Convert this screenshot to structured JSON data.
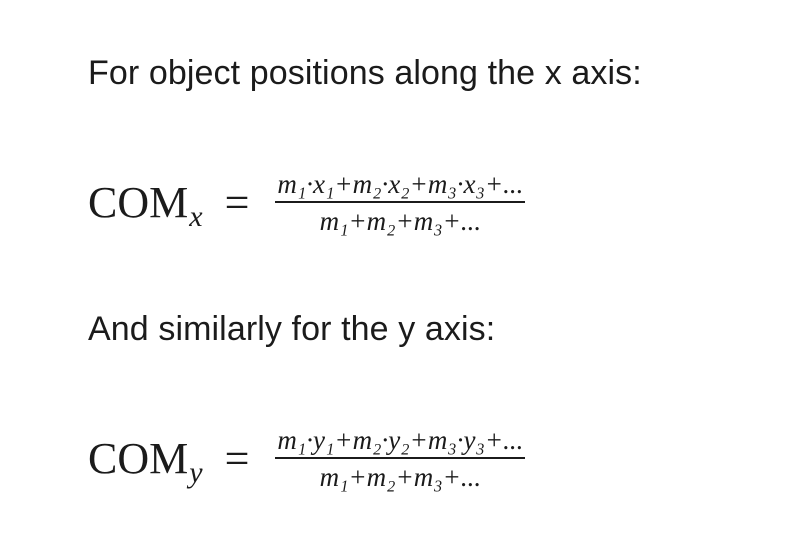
{
  "intro_text": "For object positions along the x axis:",
  "eq_x": {
    "lhs_main": "COM",
    "lhs_sub": "x",
    "equals": "=",
    "numerator": "m₁·x₁+m₂·x₂+m₃·x₃+...",
    "denominator": "m₁+m₂+m₃+..."
  },
  "similarly_text": "And similarly for the y axis:",
  "eq_y": {
    "lhs_main": "COM",
    "lhs_sub": "y",
    "equals": "=",
    "numerator": "m₁·y₁+m₂·y₂+m₃·y₃+...",
    "denominator": "m₁+m₂+m₃+..."
  }
}
